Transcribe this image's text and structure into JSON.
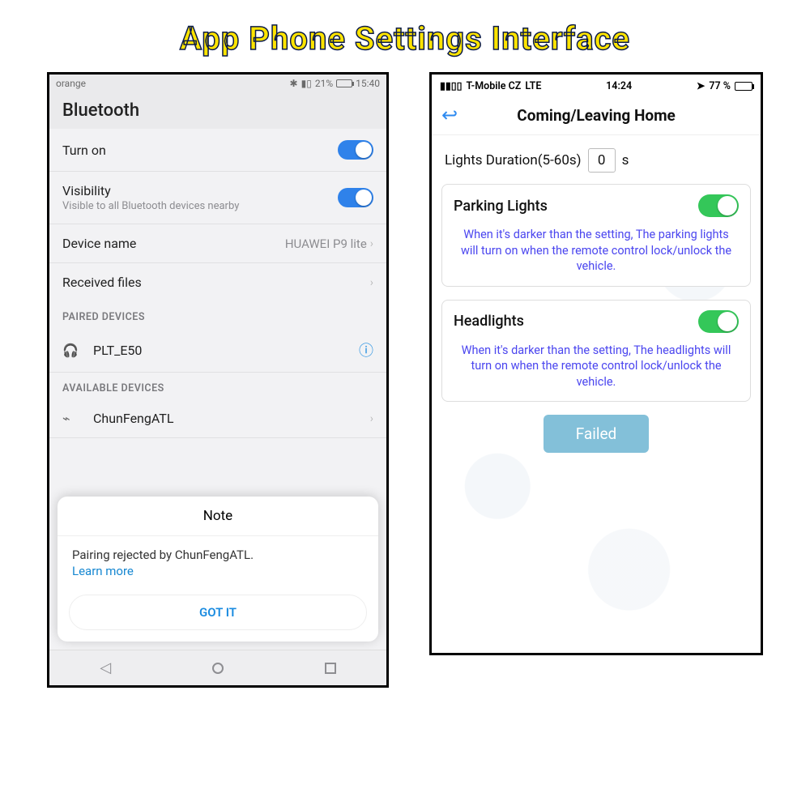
{
  "page_title": "App Phone Settings Interface",
  "android": {
    "status": {
      "carrier": "orange",
      "battery_pct": "21%",
      "time": "15:40"
    },
    "header": "Bluetooth",
    "rows": {
      "turn_on": "Turn on",
      "visibility": "Visibility",
      "visibility_sub": "Visible to all Bluetooth devices nearby",
      "device_name_label": "Device name",
      "device_name_value": "HUAWEI P9 lite",
      "received_files": "Received files"
    },
    "sections": {
      "paired": "PAIRED DEVICES",
      "available": "AVAILABLE DEVICES"
    },
    "paired_device": "PLT_E50",
    "available_device": "ChunFengATL",
    "dialog": {
      "title": "Note",
      "message": "Pairing rejected by ChunFengATL.",
      "learn": "Learn more",
      "button": "GOT IT"
    }
  },
  "ios": {
    "status": {
      "carrier": "T-Mobile CZ",
      "network": "LTE",
      "time": "14:24",
      "battery": "77 %"
    },
    "title": "Coming/Leaving Home",
    "duration_label": "Lights Duration(5-60s)",
    "duration_value": "0",
    "duration_unit": "s",
    "parking": {
      "title": "Parking Lights",
      "desc": "When it's darker than the setting, The parking lights will turn on when the remote control lock/unlock the vehicle."
    },
    "headlights": {
      "title": "Headlights",
      "desc": "When it's darker than the setting, The headlights will turn on when the remote control lock/unlock the vehicle."
    },
    "failed": "Failed"
  }
}
